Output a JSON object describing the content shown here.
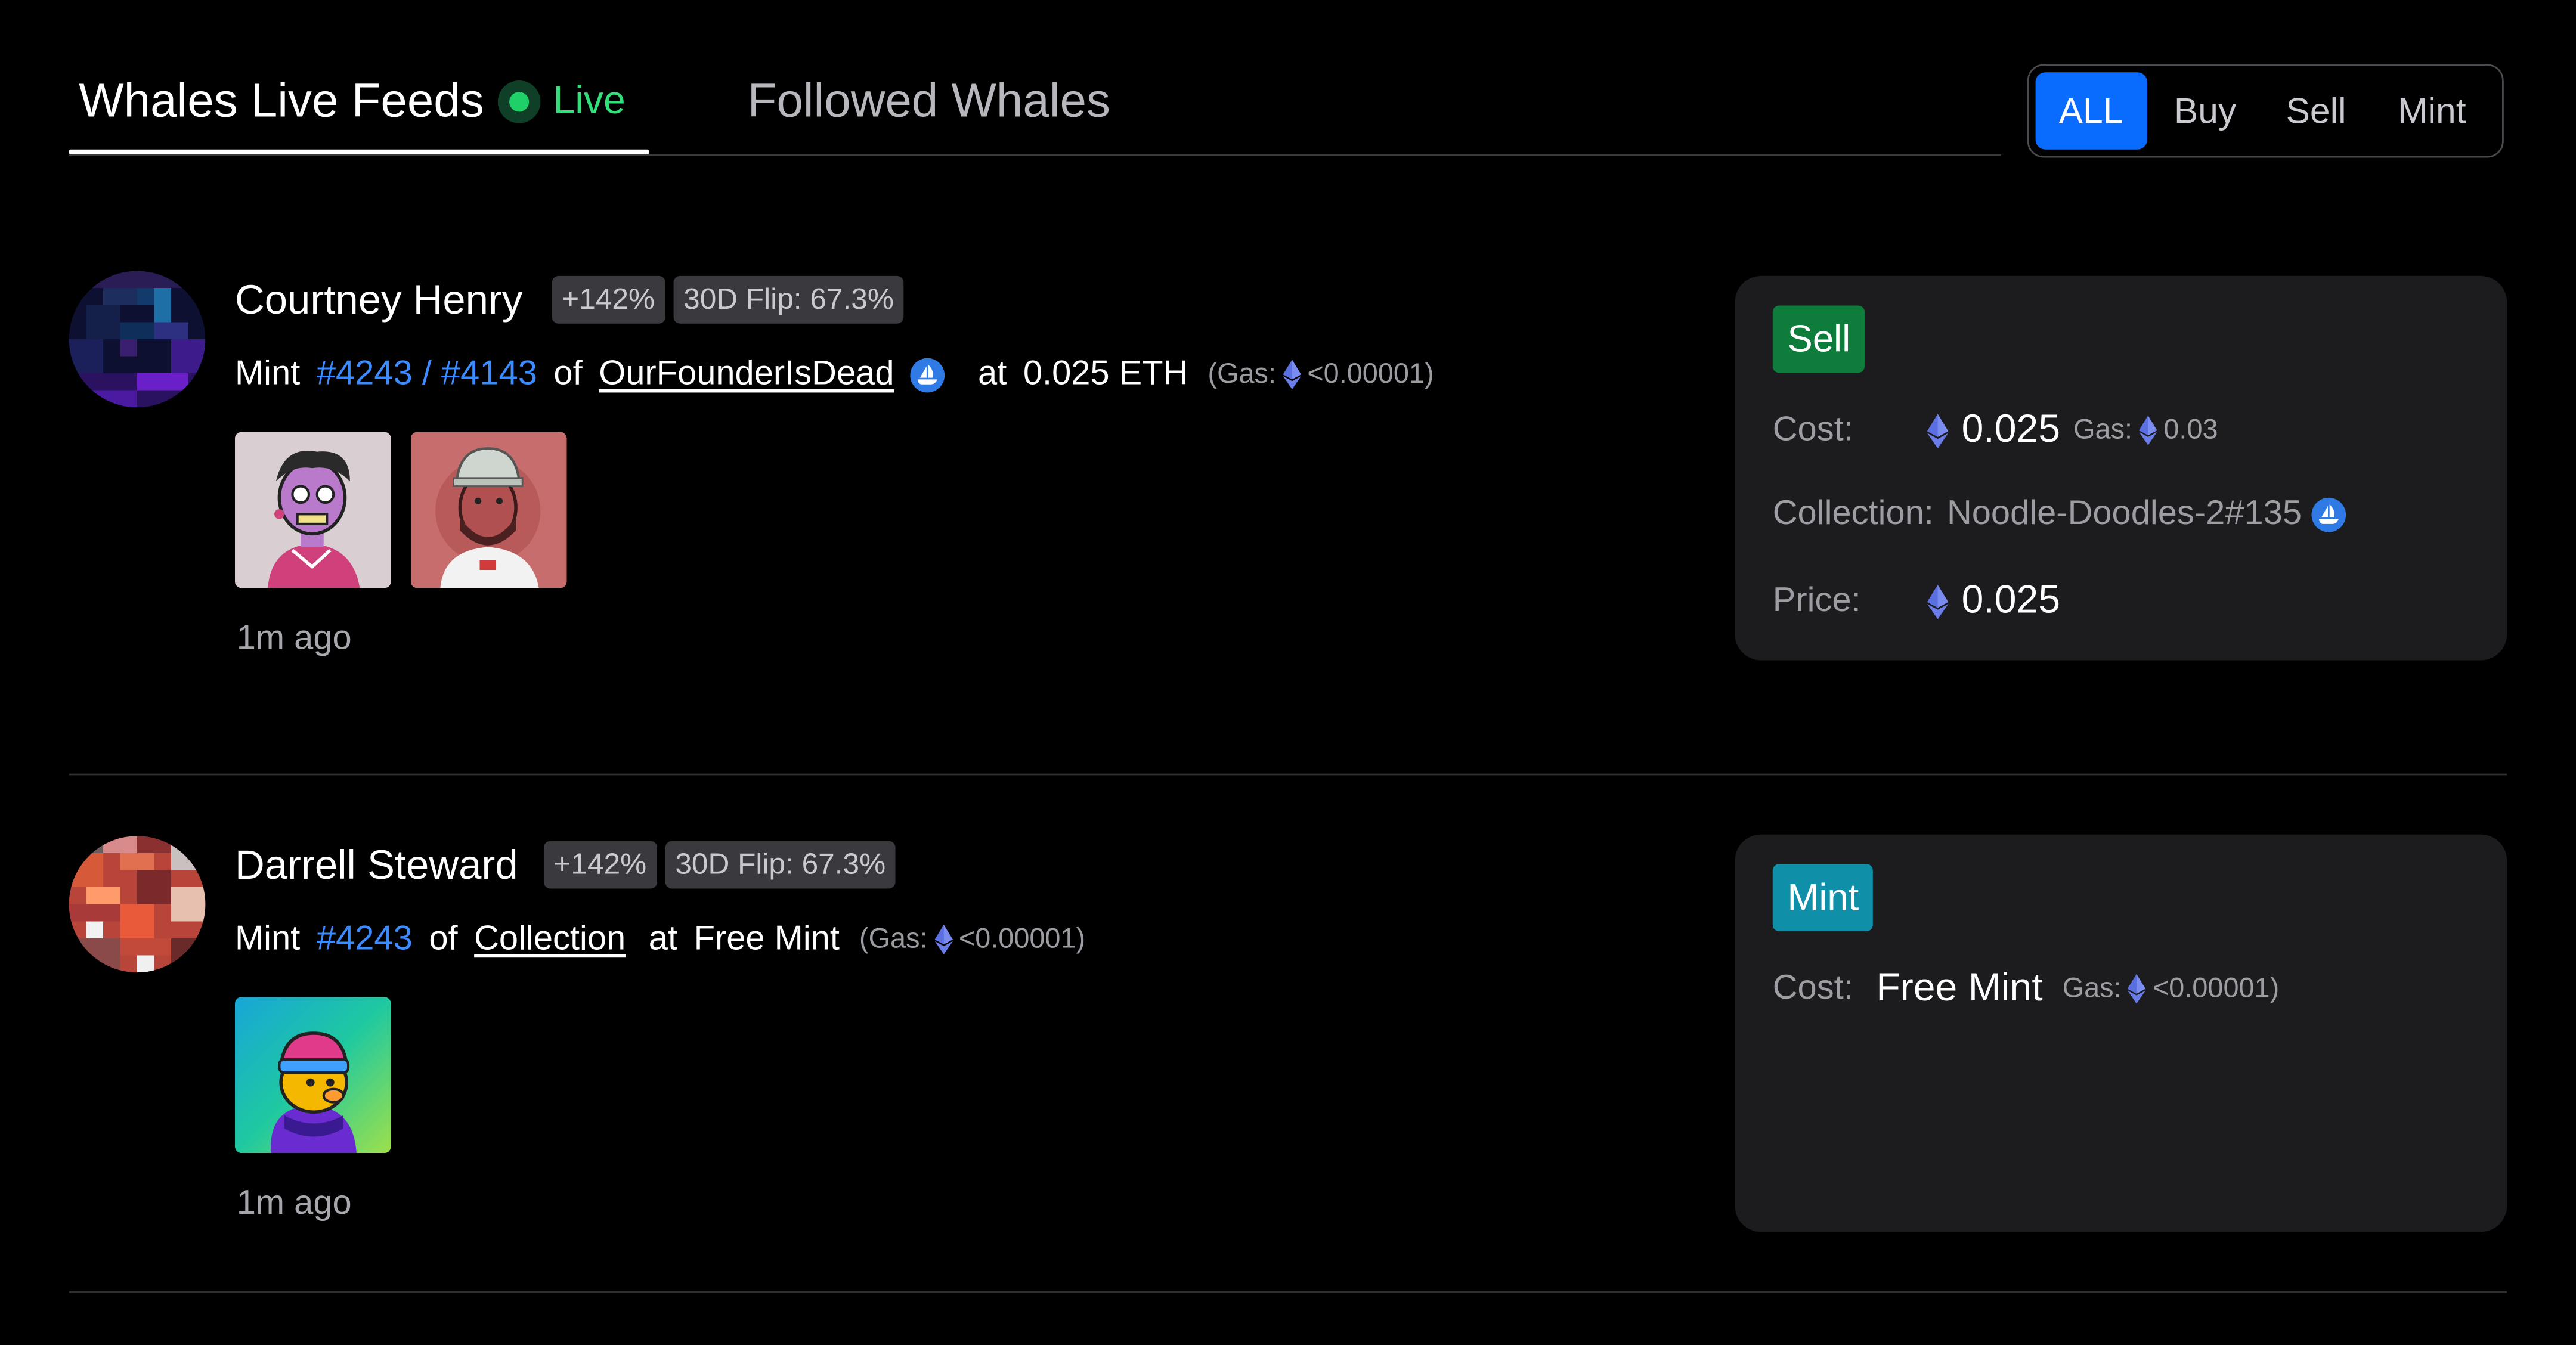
{
  "tabs": {
    "live_label": "Whales Live Feeds",
    "live_status": "Live",
    "followed_label": "Followed Whales"
  },
  "filter": {
    "all": "ALL",
    "buy": "Buy",
    "sell": "Sell",
    "mint": "Mint",
    "active": "ALL"
  },
  "colors": {
    "accent": "#0a6cff",
    "token_link": "#3d8cff",
    "live": "#33df7a",
    "sell_badge": "#0e7c3a",
    "mint_badge": "#108fa9"
  },
  "feed": [
    {
      "name": "Courtney Henry",
      "badge_pct": "+142%",
      "badge_flip": "30D Flip: 67.3%",
      "action": "Mint",
      "token": "#4243 / #4143",
      "of": "of",
      "collection": "OurFounderIsDead",
      "at": "at",
      "price": "0.025 ETH",
      "gas_prefix": "(Gas:",
      "gas_value": "<0.00001)",
      "time_ago": "1m ago",
      "card": {
        "type": "Sell",
        "cost_label": "Cost:",
        "cost_value": "0.025",
        "gas_label": "Gas:",
        "gas_value": "0.03",
        "collection_label": "Collection:",
        "collection_value": "Noodle-Doodles-2#135",
        "price_label": "Price:",
        "price_value": "0.025"
      }
    },
    {
      "name": "Darrell Steward",
      "badge_pct": "+142%",
      "badge_flip": "30D Flip: 67.3%",
      "action": "Mint",
      "token": "#4243",
      "of": "of",
      "collection": "Collection",
      "at": "at",
      "price": "Free Mint",
      "gas_prefix": "(Gas:",
      "gas_value": "<0.00001)",
      "time_ago": "1m ago",
      "card": {
        "type": "Mint",
        "cost_label": "Cost:",
        "cost_value": "Free Mint",
        "gas_label": "Gas:",
        "gas_value": "<0.00001)"
      }
    }
  ]
}
